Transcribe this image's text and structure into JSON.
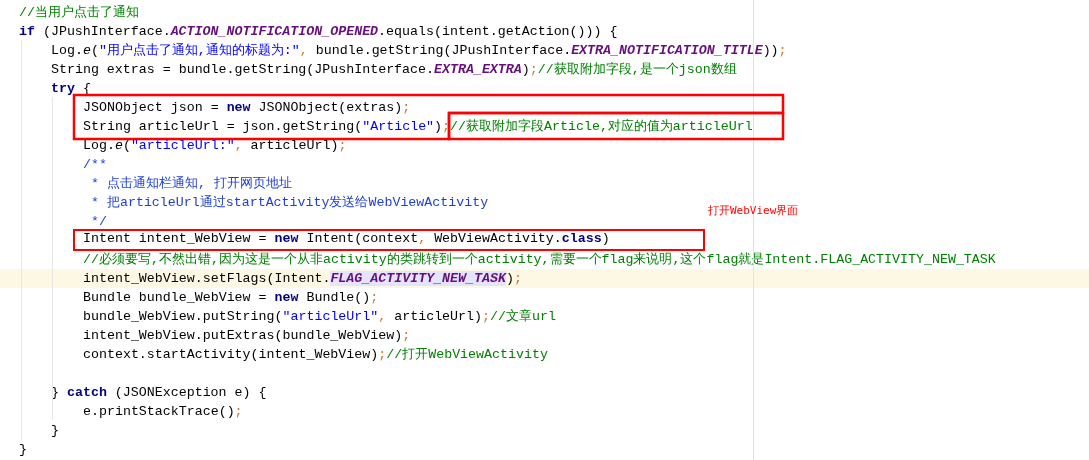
{
  "code_lines": [
    {
      "current": false,
      "tokens": [
        {
          "kind": "comment",
          "text": "//当用户点击了通知"
        }
      ]
    },
    {
      "current": false,
      "tokens": [
        {
          "kind": "keyword",
          "text": "if"
        },
        {
          "kind": "plain",
          "text": " (JPushInterface."
        },
        {
          "kind": "constant",
          "text": "ACTION_NOTIFICATION_OPENED"
        },
        {
          "kind": "plain",
          "text": ".equals(intent.getAction())) {"
        }
      ],
      "children": [
        {
          "current": false,
          "tokens": [
            {
              "kind": "plain",
              "text": "Log."
            },
            {
              "kind": "static",
              "text": "e"
            },
            {
              "kind": "plain",
              "text": "("
            },
            {
              "kind": "string",
              "text": "\"用户点击了通知,通知的标题为:\""
            },
            {
              "kind": "punct",
              "text": ","
            },
            {
              "kind": "plain",
              "text": " bundle.getString(JPushInterface."
            },
            {
              "kind": "constant",
              "text": "EXTRA_NOTIFICATION_TITLE"
            },
            {
              "kind": "plain",
              "text": "))"
            },
            {
              "kind": "punct",
              "text": ";"
            }
          ]
        },
        {
          "current": false,
          "tokens": [
            {
              "kind": "plain",
              "text": "String extras = bundle.getString(JPushInterface."
            },
            {
              "kind": "constant",
              "text": "EXTRA_EXTRA"
            },
            {
              "kind": "plain",
              "text": ")"
            },
            {
              "kind": "punct",
              "text": ";"
            },
            {
              "kind": "comment",
              "text": "//获取附加字段,是一个json数组"
            }
          ]
        },
        {
          "current": false,
          "tokens": [
            {
              "kind": "keyword",
              "text": "try"
            },
            {
              "kind": "plain",
              "text": " {"
            }
          ],
          "children": [
            {
              "current": false,
              "tokens": [
                {
                  "kind": "plain",
                  "text": "JSONObject json = "
                },
                {
                  "kind": "keyword",
                  "text": "new"
                },
                {
                  "kind": "plain",
                  "text": " JSONObject(extras)"
                },
                {
                  "kind": "punct",
                  "text": ";"
                }
              ]
            },
            {
              "current": false,
              "tokens": [
                {
                  "kind": "plain",
                  "text": "String articleUrl = json.getString("
                },
                {
                  "kind": "string",
                  "text": "\"Article\""
                },
                {
                  "kind": "plain",
                  "text": ")"
                },
                {
                  "kind": "punct",
                  "text": ";"
                },
                {
                  "kind": "comment",
                  "text": "//获取附加字段Article,对应的值为articleUrl"
                }
              ]
            },
            {
              "current": false,
              "tokens": [
                {
                  "kind": "plain",
                  "text": "Log."
                },
                {
                  "kind": "static",
                  "text": "e"
                },
                {
                  "kind": "plain",
                  "text": "("
                },
                {
                  "kind": "string",
                  "text": "\"articleUrl:\""
                },
                {
                  "kind": "punct",
                  "text": ","
                },
                {
                  "kind": "plain",
                  "text": " articleUrl)"
                },
                {
                  "kind": "punct",
                  "text": ";"
                }
              ]
            },
            {
              "current": false,
              "tokens": [
                {
                  "kind": "doc",
                  "text": "/**"
                }
              ]
            },
            {
              "current": false,
              "tokens": [
                {
                  "kind": "doc",
                  "text": " * 点击通知栏通知, 打开网页地址"
                }
              ]
            },
            {
              "current": false,
              "tokens": [
                {
                  "kind": "doc",
                  "text": " * 把articleUrl通过startActivity发送给WebViewActivity"
                }
              ]
            },
            {
              "current": false,
              "tokens": [
                {
                  "kind": "doc",
                  "text": " */"
                }
              ]
            },
            {
              "current": false,
              "outlined": true,
              "tokens": [
                {
                  "kind": "plain",
                  "text": "Intent intent_WebView = "
                },
                {
                  "kind": "keyword",
                  "text": "new"
                },
                {
                  "kind": "plain",
                  "text": " Intent(context"
                },
                {
                  "kind": "punct",
                  "text": ","
                },
                {
                  "kind": "plain",
                  "text": " WebViewActivity."
                },
                {
                  "kind": "keyword",
                  "text": "class"
                },
                {
                  "kind": "plain",
                  "text": ")"
                }
              ]
            },
            {
              "current": false,
              "tokens": [
                {
                  "kind": "comment",
                  "text": "//必须要写,不然出错,因为这是一个从非activity的类跳转到一个activity,需要一个flag来说明,这个flag就是Intent.FLAG_ACTIVITY_NEW_TASK"
                }
              ]
            },
            {
              "current": true,
              "tokens": [
                {
                  "kind": "plain",
                  "text": "intent_WebView.setFlags(Intent."
                },
                {
                  "kind": "constant-marked",
                  "text": "FLAG_ACTIVITY_NEW_TASK"
                },
                {
                  "kind": "plain",
                  "text": ")"
                },
                {
                  "kind": "punct",
                  "text": ";"
                }
              ]
            },
            {
              "current": false,
              "tokens": [
                {
                  "kind": "plain",
                  "text": "Bundle bundle_WebView = "
                },
                {
                  "kind": "keyword",
                  "text": "new"
                },
                {
                  "kind": "plain",
                  "text": " Bundle()"
                },
                {
                  "kind": "punct",
                  "text": ";"
                }
              ]
            },
            {
              "current": false,
              "tokens": [
                {
                  "kind": "plain",
                  "text": "bundle_WebView.putString("
                },
                {
                  "kind": "string",
                  "text": "\"articleUrl\""
                },
                {
                  "kind": "punct",
                  "text": ","
                },
                {
                  "kind": "plain",
                  "text": " articleUrl)"
                },
                {
                  "kind": "punct",
                  "text": ";"
                },
                {
                  "kind": "comment",
                  "text": "//文章url"
                }
              ]
            },
            {
              "current": false,
              "tokens": [
                {
                  "kind": "plain",
                  "text": "intent_WebView.putExtras(bundle_WebView)"
                },
                {
                  "kind": "punct",
                  "text": ";"
                }
              ]
            },
            {
              "current": false,
              "blank_after": true,
              "tokens": [
                {
                  "kind": "plain",
                  "text": "context.startActivity(intent_WebView)"
                },
                {
                  "kind": "punct",
                  "text": ";"
                },
                {
                  "kind": "comment",
                  "text": "//打开WebViewActivity"
                }
              ]
            }
          ]
        },
        {
          "current": false,
          "tokens": [
            {
              "kind": "plain",
              "text": "} "
            },
            {
              "kind": "keyword",
              "text": "catch"
            },
            {
              "kind": "plain",
              "text": " (JSONException e) {"
            }
          ],
          "children": [
            {
              "current": false,
              "tokens": [
                {
                  "kind": "plain",
                  "text": "e.printStackTrace()"
                },
                {
                  "kind": "punct",
                  "text": ";"
                }
              ]
            }
          ]
        },
        {
          "current": false,
          "tokens": [
            {
              "kind": "plain",
              "text": "}"
            }
          ]
        }
      ]
    },
    {
      "current": false,
      "tokens": [
        {
          "kind": "plain",
          "text": "}"
        }
      ]
    }
  ],
  "annotation": "打开WebView界面"
}
